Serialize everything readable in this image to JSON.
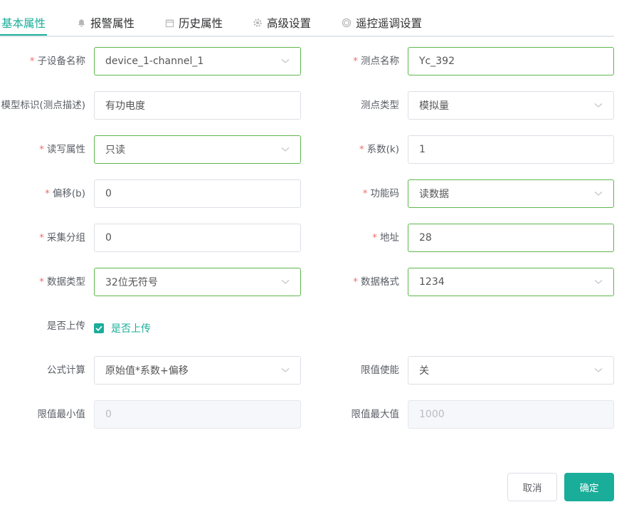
{
  "tabs": [
    {
      "label": "基本属性",
      "icon": "",
      "active": true
    },
    {
      "label": "报警属性",
      "icon": "bell-icon"
    },
    {
      "label": "历史属性",
      "icon": "calendar-icon"
    },
    {
      "label": "高级设置",
      "icon": "gear-icon"
    },
    {
      "label": "遥控遥调设置",
      "icon": "circle-icon"
    }
  ],
  "form": {
    "sub_device_name": {
      "label": "子设备名称",
      "required": true,
      "value": "device_1-channel_1"
    },
    "point_name": {
      "label": "测点名称",
      "required": true,
      "value": "Yc_392"
    },
    "model_id": {
      "label": "模型标识(测点描述)",
      "required": false,
      "value": "有功电度"
    },
    "point_type": {
      "label": "测点类型",
      "required": false,
      "value": "模拟量"
    },
    "rw_attr": {
      "label": "读写属性",
      "required": true,
      "value": "只读"
    },
    "coefficient": {
      "label": "系数(k)",
      "required": true,
      "value": "1"
    },
    "offset": {
      "label": "偏移(b)",
      "required": true,
      "value": "0"
    },
    "function_code": {
      "label": "功能码",
      "required": true,
      "value": "读数据"
    },
    "collect_group": {
      "label": "采集分组",
      "required": true,
      "value": "0"
    },
    "address": {
      "label": "地址",
      "required": true,
      "value": "28"
    },
    "data_type": {
      "label": "数据类型",
      "required": true,
      "value": "32位无符号"
    },
    "data_format": {
      "label": "数据格式",
      "required": true,
      "value": "1234"
    },
    "upload": {
      "label": "是否上传",
      "checkbox_label": "是否上传",
      "checked": true
    },
    "formula": {
      "label": "公式计算",
      "required": false,
      "value": "原始值*系数+偏移"
    },
    "limit_enable": {
      "label": "限值使能",
      "required": false,
      "value": "关"
    },
    "limit_min": {
      "label": "限值最小值",
      "required": false,
      "placeholder": "0"
    },
    "limit_max": {
      "label": "限值最大值",
      "required": false,
      "placeholder": "1000"
    }
  },
  "buttons": {
    "cancel": "取消",
    "confirm": "确定"
  },
  "colors": {
    "accent": "#1aad9a",
    "valid_border": "#5fb64d",
    "required": "#f56c6c"
  }
}
